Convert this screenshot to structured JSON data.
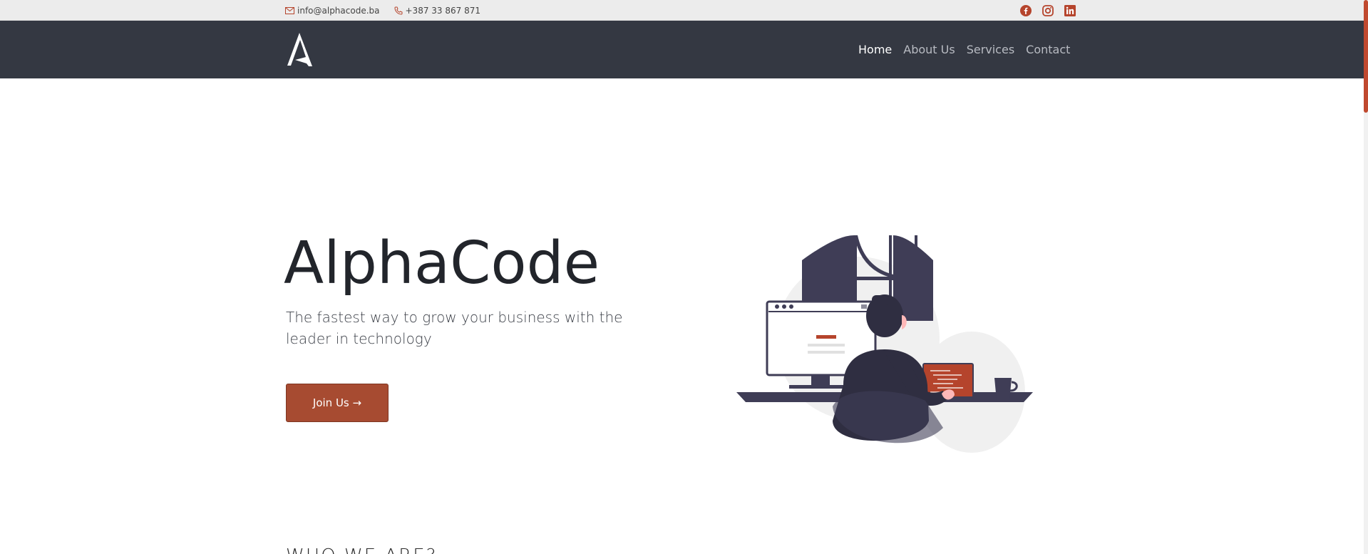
{
  "topbar": {
    "email": "info@alphacode.ba",
    "phone": "+387 33 867 871",
    "social": [
      {
        "icon": "facebook-icon"
      },
      {
        "icon": "instagram-icon"
      },
      {
        "icon": "linkedin-icon"
      }
    ]
  },
  "nav": {
    "links": [
      "Home",
      "About Us",
      "Services",
      "Contact"
    ],
    "active": "Home"
  },
  "hero": {
    "title": "AlphaCode",
    "subtitle": "The fastest way to grow your business with the leader in technology",
    "button_label": "Join Us →"
  },
  "section": {
    "heading": "WHO WE ARE?"
  },
  "colors": {
    "accent": "#a74b31",
    "nav_bg": "#343842",
    "topbar_bg": "#ececec"
  }
}
